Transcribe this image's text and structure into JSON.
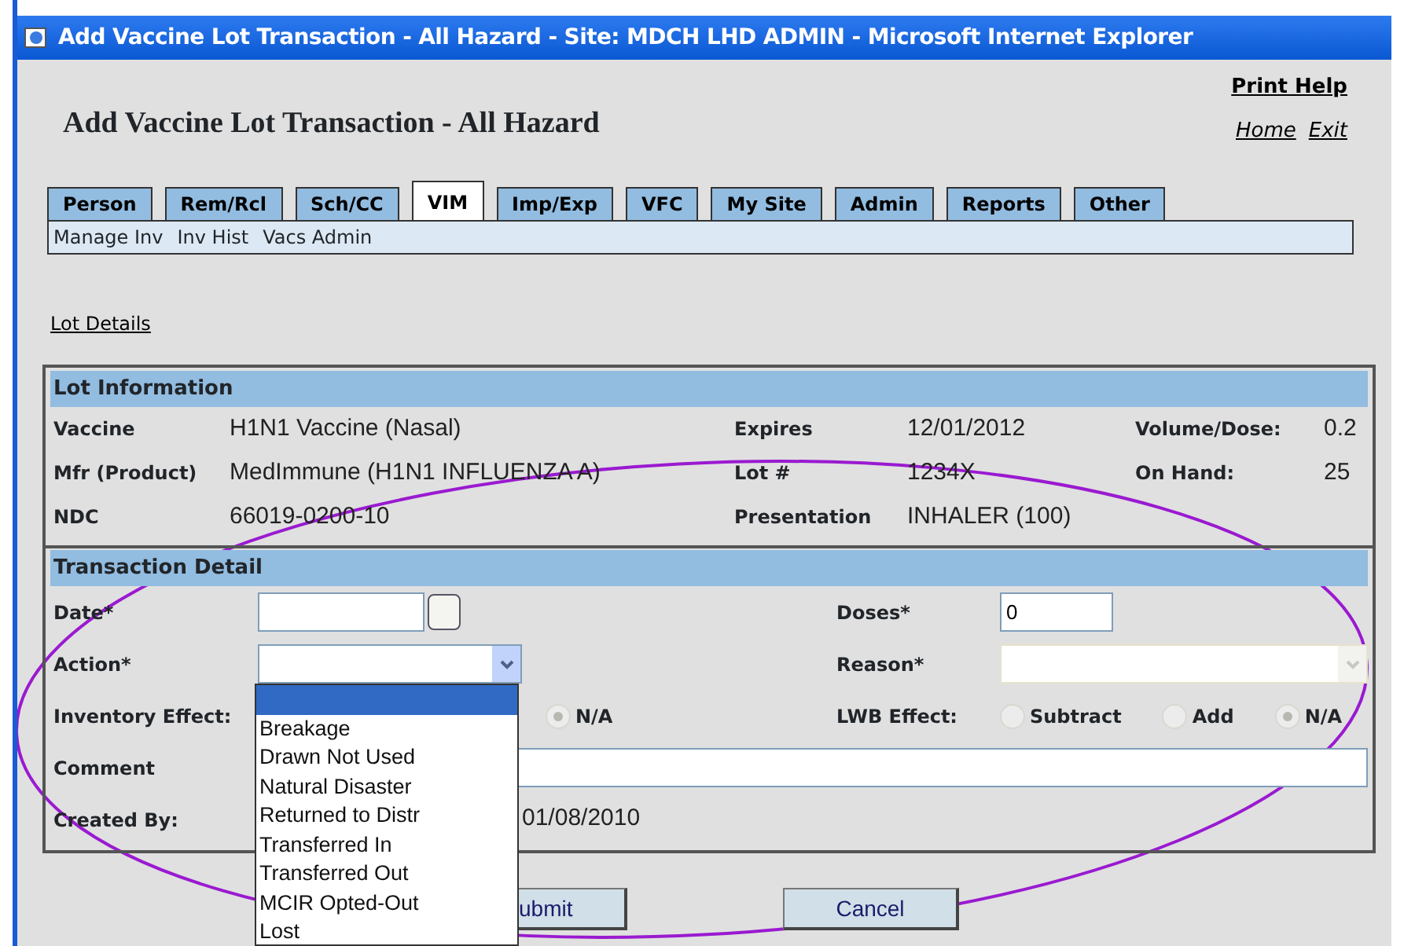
{
  "window": {
    "title": "Add Vaccine Lot Transaction - All Hazard - Site: MDCH LHD ADMIN - Microsoft Internet Explorer"
  },
  "header": {
    "title": "Add Vaccine Lot Transaction - All Hazard",
    "print_help": "Print Help",
    "links": [
      "Home",
      "Exit"
    ]
  },
  "tabs": [
    {
      "label": "Person",
      "selected": false
    },
    {
      "label": "Rem/Rcl",
      "selected": false
    },
    {
      "label": "Sch/CC",
      "selected": false
    },
    {
      "label": "VIM",
      "selected": true
    },
    {
      "label": "Imp/Exp",
      "selected": false
    },
    {
      "label": "VFC",
      "selected": false
    },
    {
      "label": "My Site",
      "selected": false
    },
    {
      "label": "Admin",
      "selected": false
    },
    {
      "label": "Reports",
      "selected": false
    },
    {
      "label": "Other",
      "selected": false
    }
  ],
  "subnav": [
    "Manage Inv",
    "Inv Hist",
    "Vacs Admin"
  ],
  "breadcrumb": "Lot Details",
  "lot_information": {
    "heading": "Lot Information",
    "rows": [
      [
        {
          "label": "Vaccine",
          "value": "H1N1 Vaccine (Nasal)"
        },
        {
          "label": "Expires",
          "value": "12/01/2012"
        },
        {
          "label": "Volume/Dose:",
          "value": "0.2"
        }
      ],
      [
        {
          "label": "Mfr (Product)",
          "value": "MedImmune (H1N1 INFLUENZA A)"
        },
        {
          "label": "Lot #",
          "value": "1234X"
        },
        {
          "label": "On Hand:",
          "value": "25"
        }
      ],
      [
        {
          "label": "NDC",
          "value": "66019-0200-10"
        },
        {
          "label": "Presentation",
          "value": "INHALER (100)"
        }
      ]
    ]
  },
  "transaction_detail": {
    "heading": "Transaction Detail",
    "date": {
      "label": "Date*"
    },
    "doses": {
      "label": "Doses*",
      "value": "0"
    },
    "action": {
      "label": "Action*",
      "expanded": true,
      "options": [
        {
          "selected": true
        },
        {
          "label": "Breakage",
          "selected": false
        },
        {
          "label": "Drawn Not Used",
          "selected": false
        },
        {
          "label": "Natural Disaster",
          "selected": false
        },
        {
          "label": "Returned to Distr",
          "selected": false
        },
        {
          "label": "Transferred In",
          "selected": false
        },
        {
          "label": "Transferred Out",
          "selected": false
        },
        {
          "label": "MCIR Opted-Out",
          "selected": false
        },
        {
          "label": "Lost",
          "selected": false
        }
      ]
    },
    "reason": {
      "label": "Reason*",
      "disabled": true
    },
    "inventory_effect": {
      "label": "Inventory Effect:",
      "options": [
        {
          "label": "N/A",
          "selected": true
        }
      ]
    },
    "lwb_effect": {
      "label": "LWB Effect:",
      "options": [
        {
          "label": "Subtract",
          "selected": false
        },
        {
          "label": "Add",
          "selected": false
        },
        {
          "label": "N/A",
          "selected": true
        }
      ]
    },
    "comment": {
      "label": "Comment"
    },
    "created_by": {
      "label": "Created By:",
      "value": "01/08/2010"
    }
  },
  "buttons": [
    "ubmit",
    "Cancel"
  ]
}
